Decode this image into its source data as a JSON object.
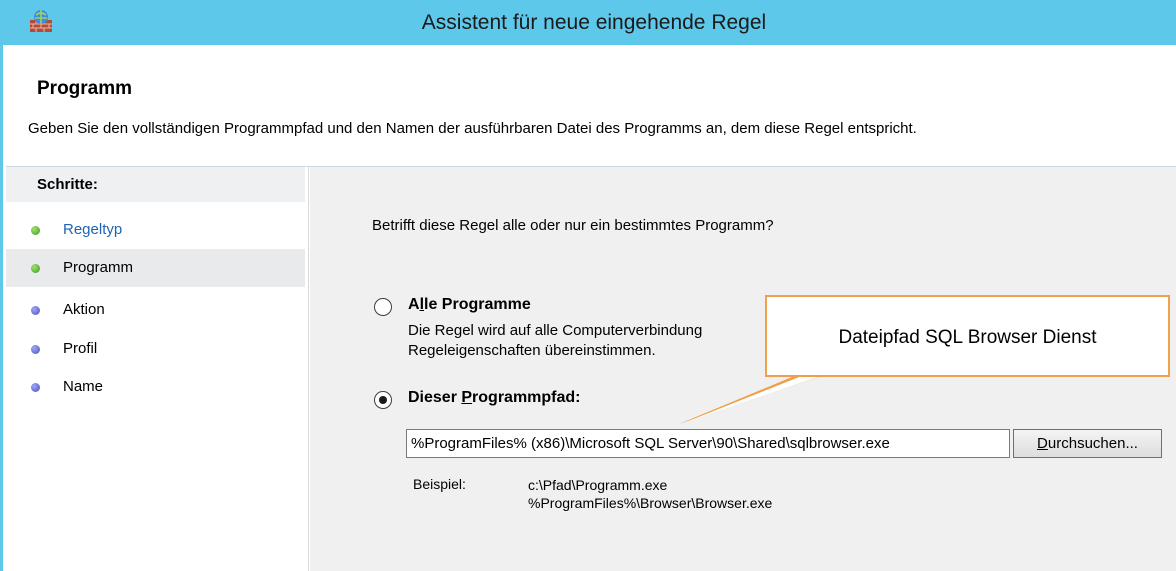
{
  "window": {
    "title": "Assistent für neue eingehende Regel"
  },
  "header": {
    "title": "Programm",
    "description": "Geben Sie den vollständigen Programmpfad und den Namen der ausführbaren Datei des Programms an, dem diese Regel entspricht."
  },
  "steps": {
    "title": "Schritte:",
    "items": [
      {
        "label": "Regeltyp",
        "state": "done"
      },
      {
        "label": "Programm",
        "state": "current"
      },
      {
        "label": "Aktion",
        "state": "pending"
      },
      {
        "label": "Profil",
        "state": "pending"
      },
      {
        "label": "Name",
        "state": "pending"
      }
    ]
  },
  "content": {
    "question": "Betrifft diese Regel alle oder nur ein bestimmtes Programm?",
    "option_all": {
      "label_prefix": "A",
      "label_mnemonic": "l",
      "label_suffix": "le Programme",
      "desc_line1": "Die Regel wird auf alle Computerverbindung",
      "desc_line2": "Regeleigenschaften übereinstimmen.",
      "selected": false
    },
    "option_path": {
      "label_prefix": "Dieser ",
      "label_mnemonic": "P",
      "label_suffix": "rogrammpfad:",
      "selected": true
    },
    "path_value": "%ProgramFiles% (x86)\\Microsoft SQL Server\\90\\Shared\\sqlbrowser.exe",
    "browse_prefix": "",
    "browse_mnemonic": "D",
    "browse_suffix": "urchsuchen...",
    "example_label": "Beispiel:",
    "example_line1": "c:\\Pfad\\Programm.exe",
    "example_line2": "%ProgramFiles%\\Browser\\Browser.exe"
  },
  "callout": {
    "text": "Dateipfad SQL Browser Dienst"
  },
  "colors": {
    "titlebar": "#5ec8ea",
    "callout_border": "#f0a04b",
    "link": "#1e64b4"
  }
}
